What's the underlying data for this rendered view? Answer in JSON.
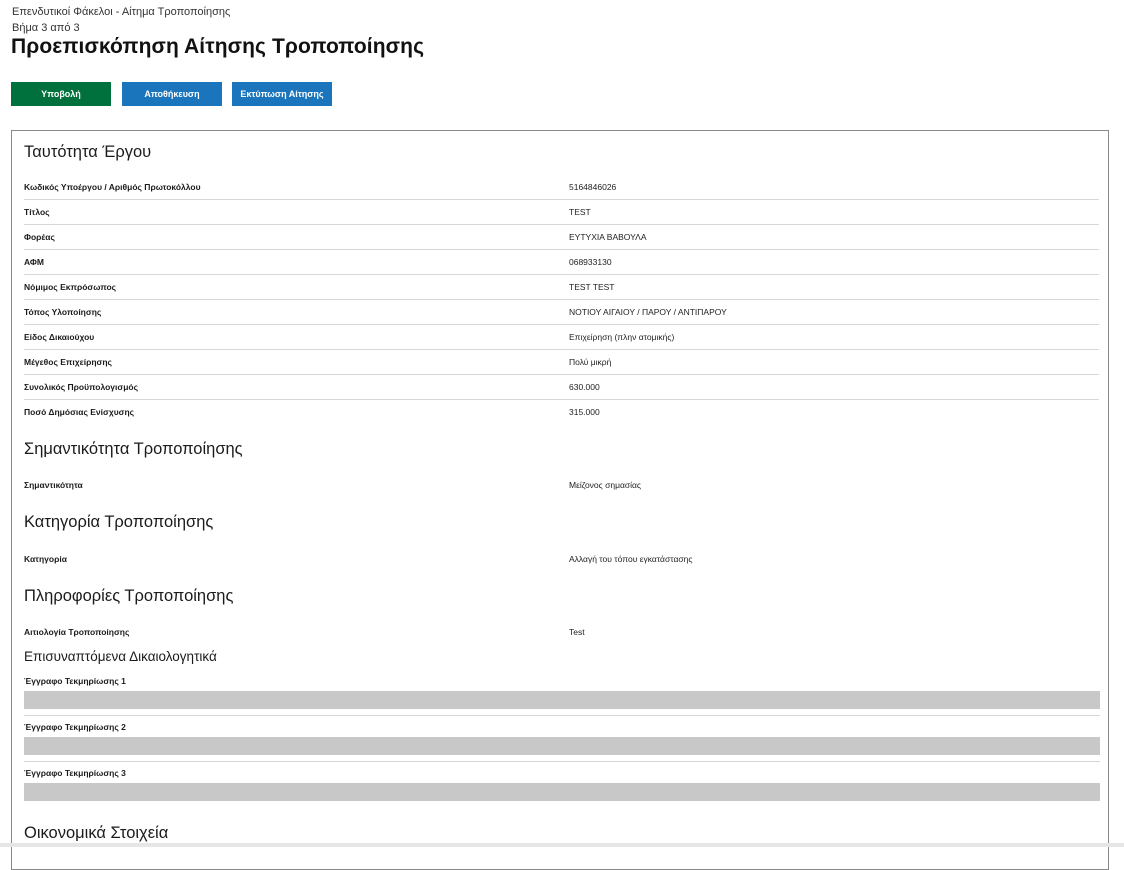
{
  "header": {
    "breadcrumb": "Επενδυτικοί Φάκελοι - Αίτημα Τροποποίησης",
    "step": "Βήμα 3 από 3",
    "title": "Προεπισκόπηση Αίτησης Τροποποίησης"
  },
  "toolbar": {
    "submit_label": "Υποβολή",
    "save_label": "Αποθήκευση",
    "print_label": "Εκτύπωση Αίτησης",
    "submit_color": "#00703c",
    "action_color": "#1b75bc"
  },
  "project_identity": {
    "heading": "Ταυτότητα Έργου",
    "rows": [
      {
        "label": "Κωδικός Υποέργου / Αριθμός Πρωτοκόλλου",
        "value": "5164846026"
      },
      {
        "label": "Τίτλος",
        "value": "TEST"
      },
      {
        "label": "Φορέας",
        "value": "ΕΥΤΥΧΙΑ ΒΑΒΟΥΛΑ"
      },
      {
        "label": "ΑΦΜ",
        "value": "068933130"
      },
      {
        "label": "Νόμιμος Εκπρόσωπος",
        "value": "TEST TEST"
      },
      {
        "label": "Τόπος Υλοποίησης",
        "value": "ΝΟΤΙΟΥ ΑΙΓΑΙΟΥ / ΠΑΡΟΥ / ΑΝΤΙΠΑΡΟΥ"
      },
      {
        "label": "Είδος Δικαιούχου",
        "value": "Επιχείρηση (πλην ατομικής)"
      },
      {
        "label": "Μέγεθος Επιχείρησης",
        "value": "Πολύ μικρή"
      },
      {
        "label": "Συνολικός Προϋπολογισμός",
        "value": "630.000"
      },
      {
        "label": "Ποσό Δημόσιας Ενίσχυσης",
        "value": "315.000"
      }
    ]
  },
  "significance": {
    "heading": "Σημαντικότητα Τροποποίησης",
    "label": "Σημαντικότητα",
    "value": "Μείζονος σημασίας"
  },
  "category": {
    "heading": "Κατηγορία Τροποποίησης",
    "label": "Κατηγορία",
    "value": "Αλλαγή του τόπου εγκατάστασης"
  },
  "info": {
    "heading": "Πληροφορίες Τροποποίησης",
    "label": "Αιτιολογία Τροποποίησης",
    "value": "Test"
  },
  "attachments": {
    "heading": "Επισυναπτόμενα Δικαιολογητικά",
    "docs": [
      {
        "label": "Έγγραφο Τεκμηρίωσης 1"
      },
      {
        "label": "Έγγραφο Τεκμηρίωσης 2"
      },
      {
        "label": "Έγγραφο Τεκμηρίωσης 3"
      }
    ]
  },
  "financial": {
    "heading": "Οικονομικά Στοιχεία"
  }
}
